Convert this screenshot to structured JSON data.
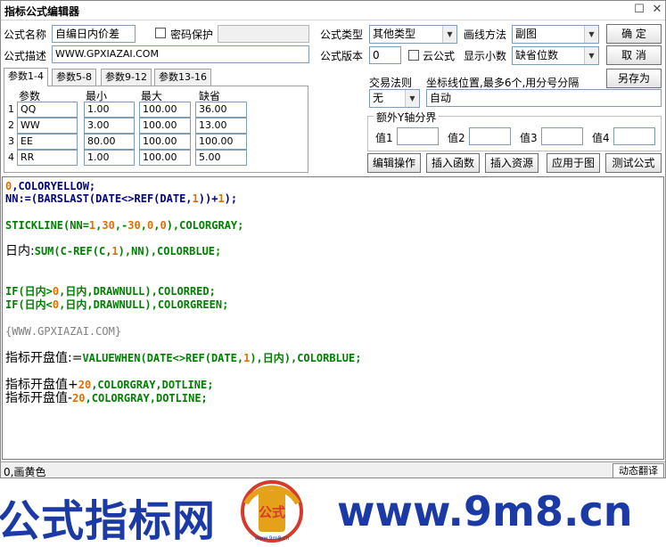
{
  "window": {
    "title": "指标公式编辑器"
  },
  "form": {
    "name_label": "公式名称",
    "name_value": "自编日内价差",
    "password_label": "密码保护",
    "desc_label": "公式描述",
    "desc_value": "WWW.GPXIAZAI.COM",
    "type_label": "公式类型",
    "type_value": "其他类型",
    "draw_label": "画线方法",
    "draw_value": "副图",
    "version_label": "公式版本",
    "version_value": "0",
    "cloud_label": "云公式",
    "decimals_label": "显示小数",
    "decimals_value": "缺省位数",
    "trade_label": "交易法则",
    "trade_value": "无",
    "coord_label": "坐标线位置,最多6个,用分号分隔",
    "coord_value": "自动",
    "yaxis_title": "额外Y轴分界",
    "yaxis": [
      "值1",
      "值2",
      "值3",
      "值4"
    ]
  },
  "buttons": {
    "ok": "确  定",
    "cancel": "取  消",
    "save_as": "另存为",
    "edit": "编辑操作",
    "insert_func": "插入函数",
    "insert_res": "插入资源",
    "apply": "应用于图",
    "test": "测试公式"
  },
  "tabs": [
    "参数1-4",
    "参数5-8",
    "参数9-12",
    "参数13-16"
  ],
  "params": {
    "headers": [
      "参数",
      "最小",
      "最大",
      "缺省"
    ],
    "rows": [
      {
        "n": "1",
        "name": "QQ",
        "min": "1.00",
        "max": "100.00",
        "def": "36.00"
      },
      {
        "n": "2",
        "name": "WW",
        "min": "3.00",
        "max": "100.00",
        "def": "13.00"
      },
      {
        "n": "3",
        "name": "EE",
        "min": "80.00",
        "max": "100.00",
        "def": "100.00"
      },
      {
        "n": "4",
        "name": "RR",
        "min": "1.00",
        "max": "100.00",
        "def": "5.00"
      }
    ]
  },
  "code": {
    "l1": [
      "0",
      ",COLORYELLOW;"
    ],
    "l2": [
      "NN:=(BARSLAST(DATE<>REF(DATE,",
      "1",
      "))+",
      "1",
      ");"
    ],
    "l3": [
      "STICKLINE(NN=",
      "1",
      ",",
      "30",
      ",-",
      "30",
      ",",
      "0",
      ",",
      "0",
      "),COLORGRAY;"
    ],
    "l4": [
      "日内:",
      "SUM(C-REF(C,",
      "1",
      "),NN),COLORBLUE;"
    ],
    "l5": [
      "IF(日内>",
      "0",
      ",日内,DRAWNULL),COLORRED;"
    ],
    "l6": [
      "IF(日内<",
      "0",
      ",日内,DRAWNULL),COLORGREEN;"
    ],
    "l7": "{WWW.GPXIAZAI.COM}",
    "l8": [
      "指标开盘值:=",
      "VALUEWHEN(DATE<>REF(DATE,",
      "1",
      "),日内),COLORBLUE;"
    ],
    "l9": [
      "指标开盘值+",
      "20",
      ",COLORGRAY,DOTLINE;"
    ],
    "l10": [
      "指标开盘值-",
      "20",
      ",COLORGRAY,DOTLINE;"
    ]
  },
  "status": {
    "text": "0,画黄色",
    "dynamic": "动态翻译"
  },
  "banner": {
    "left": "公式指标网",
    "right": "www.9m8.cn",
    "logo_text": "公式",
    "logo_small": "www.9m8.cn",
    "colors": {
      "blue": "#1b3aa6",
      "red": "#d63a2a",
      "gold": "#e3a21a"
    }
  }
}
